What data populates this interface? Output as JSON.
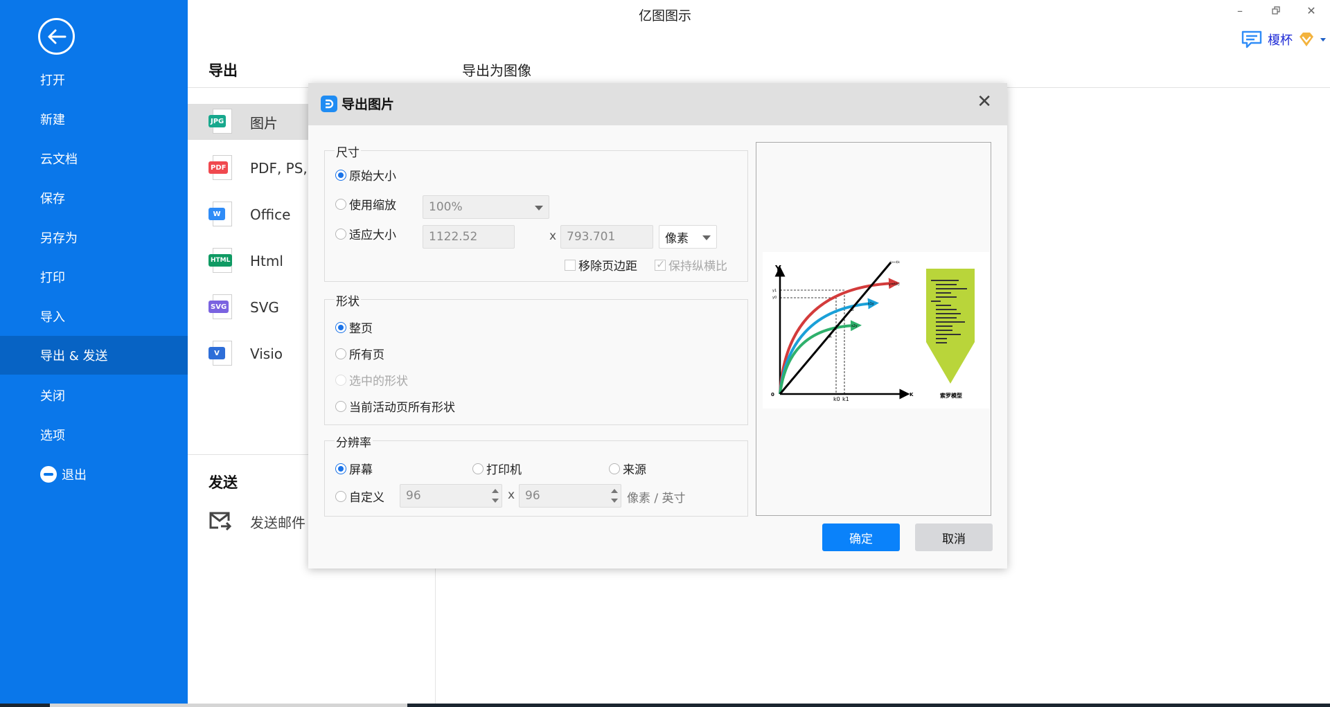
{
  "app": {
    "title": "亿图图示",
    "user_name": "榎杯",
    "window_controls": [
      "minimize",
      "restore",
      "close"
    ]
  },
  "sidebar": {
    "items": [
      {
        "label": "打开"
      },
      {
        "label": "新建"
      },
      {
        "label": "云文档"
      },
      {
        "label": "保存"
      },
      {
        "label": "另存为"
      },
      {
        "label": "打印"
      },
      {
        "label": "导入"
      },
      {
        "label": "导出 & 发送",
        "active": true
      },
      {
        "label": "关闭"
      },
      {
        "label": "选项"
      },
      {
        "label": "退出"
      }
    ]
  },
  "export_panel": {
    "heading": "导出",
    "subtitle": "导出为图像",
    "formats": [
      {
        "badge": "JPG",
        "label": "图片",
        "color": "#17a88d",
        "active": true
      },
      {
        "badge": "PDF",
        "label": "PDF, PS,",
        "color": "#f0494f"
      },
      {
        "badge": "W",
        "label": "Office",
        "color": "#2f8cf7"
      },
      {
        "badge": "HTML",
        "label": "Html",
        "color": "#0f9a63"
      },
      {
        "badge": "SVG",
        "label": "SVG",
        "color": "#7a63e0"
      },
      {
        "badge": "V",
        "label": "Visio",
        "color": "#2e6ed8"
      }
    ],
    "send_heading": "发送",
    "send_mail_label": "发送邮件"
  },
  "dialog": {
    "title": "导出图片",
    "size_group": {
      "title": "尺寸",
      "options": [
        "原始大小",
        "使用缩放",
        "适应大小"
      ],
      "selected": "原始大小",
      "zoom_value": "100%",
      "width_value": "1122.52",
      "height_value": "793.701",
      "times": "x",
      "unit_value": "像素",
      "remove_margin_label": "移除页边距",
      "remove_margin_checked": false,
      "keep_ratio_label": "保持纵横比",
      "keep_ratio_checked": true
    },
    "shape_group": {
      "title": "形状",
      "options": [
        "整页",
        "所有页",
        "选中的形状",
        "当前活动页所有形状"
      ],
      "selected": "整页",
      "disabled": [
        "选中的形状"
      ]
    },
    "resolution_group": {
      "title": "分辨率",
      "options": [
        "屏幕",
        "打印机",
        "来源",
        "自定义"
      ],
      "selected": "屏幕",
      "dpi_x": "96",
      "dpi_y": "96",
      "times": "x",
      "unit": "像素 / 英寸"
    },
    "preview": {
      "y_axis": "Y",
      "x_axis": "K",
      "origin": "0",
      "labels": {
        "y1": "y1",
        "y0": "y0",
        "k0": "k0",
        "k1": "k1",
        "A": "A",
        "B": "B",
        "line": "(n+d)k",
        "red": "y=f(k)",
        "blue": "s1y",
        "green": "s2y"
      },
      "caption": "索罗模型",
      "colors": {
        "red": "#d33b3b",
        "blue": "#1aa0d8",
        "green": "#2fb06c",
        "panel": "#b9d53a"
      }
    },
    "ok_label": "确定",
    "cancel_label": "取消"
  },
  "colors": {
    "sidebar": "#0a77ea",
    "sidebar_active": "#0763c4",
    "ok_button": "#0a82fa",
    "user_name": "#1d2ad6"
  }
}
